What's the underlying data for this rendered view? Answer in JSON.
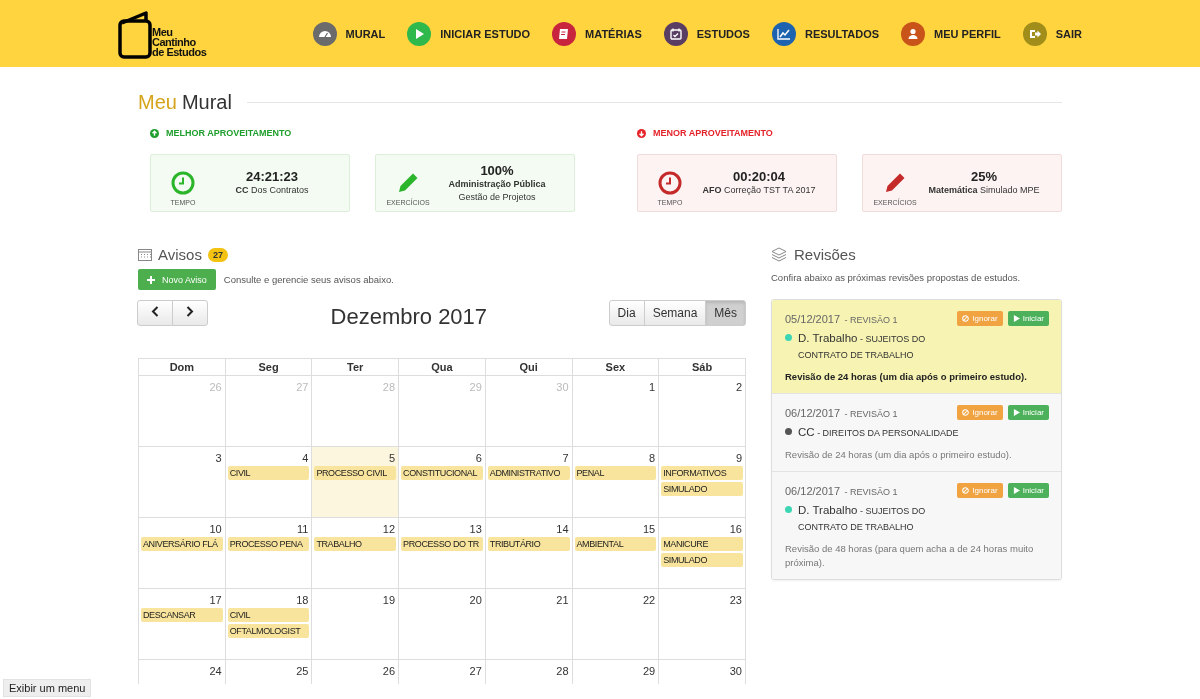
{
  "header": {
    "logo_lines": [
      "Meu",
      "Cantinho",
      "de Estudos"
    ],
    "nav": [
      {
        "kind": "dashboard",
        "label": "MURAL",
        "color": "#6b6b6b"
      },
      {
        "kind": "play",
        "label": "INICIAR ESTUDO",
        "color": "#2fb84b"
      },
      {
        "kind": "book",
        "label": "MATÉRIAS",
        "color": "#c8243d"
      },
      {
        "kind": "calendar",
        "label": "ESTUDOS",
        "color": "#5a3d63"
      },
      {
        "kind": "chart",
        "label": "RESULTADOS",
        "color": "#1e63b0"
      },
      {
        "kind": "user",
        "label": "MEU PERFIL",
        "color": "#c95419"
      },
      {
        "kind": "exit",
        "label": "SAIR",
        "color": "#a08d1a"
      }
    ]
  },
  "mural": {
    "title_accent": "Meu",
    "title": "Mural",
    "groups": [
      {
        "positive": true,
        "label": "MELHOR APROVEITAMENTO",
        "cards": [
          {
            "kind": "time",
            "caption": "TEMPO",
            "value": "24:21:23",
            "line": "**CC** Dos Contratos"
          },
          {
            "kind": "exercise",
            "caption": "EXERCÍCIOS",
            "value": "100%",
            "line": "**Administração Pública** Gestão de Projetos"
          }
        ]
      },
      {
        "positive": false,
        "label": "MENOR APROVEITAMENTO",
        "cards": [
          {
            "kind": "time",
            "caption": "TEMPO",
            "value": "00:20:04",
            "line": "**AFO** Correção TST TA 2017"
          },
          {
            "kind": "exercise",
            "caption": "EXERCÍCIOS",
            "value": "25%",
            "line": "**Matemática** Simulado MPE"
          }
        ]
      }
    ]
  },
  "avisos": {
    "title": "Avisos",
    "count": "27",
    "new_button": "Novo Aviso",
    "hint": "Consulte e gerencie seus avisos abaixo.",
    "calendar": {
      "title": "Dezembro 2017",
      "views": [
        {
          "label": "Dia",
          "selected": false
        },
        {
          "label": "Semana",
          "selected": false
        },
        {
          "label": "Mês",
          "selected": true
        }
      ],
      "weekdays": [
        "Dom",
        "Seg",
        "Ter",
        "Qua",
        "Qui",
        "Sex",
        "Sáb"
      ],
      "weeks": [
        [
          {
            "day": "26",
            "muted": true,
            "today": false
          },
          {
            "day": "27",
            "muted": true,
            "today": false
          },
          {
            "day": "28",
            "muted": true,
            "today": false
          },
          {
            "day": "29",
            "muted": true,
            "today": false
          },
          {
            "day": "30",
            "muted": true,
            "today": false
          },
          {
            "day": "1",
            "muted": false,
            "today": false
          },
          {
            "day": "2",
            "muted": false,
            "today": false
          }
        ],
        [
          {
            "day": "3",
            "muted": false,
            "today": false
          },
          {
            "day": "4",
            "muted": false,
            "today": false,
            "events": [
              "CIVIL"
            ]
          },
          {
            "day": "5",
            "muted": false,
            "today": true,
            "events": [
              "PROCESSO CIVIL"
            ]
          },
          {
            "day": "6",
            "muted": false,
            "today": false,
            "events": [
              "CONSTITUCIONAL"
            ]
          },
          {
            "day": "7",
            "muted": false,
            "today": false,
            "events": [
              "ADMINISTRATIVO"
            ]
          },
          {
            "day": "8",
            "muted": false,
            "today": false,
            "events": [
              "PENAL"
            ]
          },
          {
            "day": "9",
            "muted": false,
            "today": false,
            "events": [
              "INFORMATIVOS",
              "SIMULADO"
            ]
          }
        ],
        [
          {
            "day": "10",
            "muted": false,
            "today": false,
            "events": [
              "ANIVERSÁRIO FLÁ"
            ]
          },
          {
            "day": "11",
            "muted": false,
            "today": false,
            "events": [
              "PROCESSO PENA"
            ]
          },
          {
            "day": "12",
            "muted": false,
            "today": false,
            "events": [
              "TRABALHO"
            ]
          },
          {
            "day": "13",
            "muted": false,
            "today": false,
            "events": [
              "PROCESSO DO TR"
            ]
          },
          {
            "day": "14",
            "muted": false,
            "today": false,
            "events": [
              "TRIBUTÁRIO"
            ]
          },
          {
            "day": "15",
            "muted": false,
            "today": false,
            "events": [
              "AMBIENTAL"
            ]
          },
          {
            "day": "16",
            "muted": false,
            "today": false,
            "events": [
              "MANICURE",
              "SIMULADO"
            ]
          }
        ],
        [
          {
            "day": "17",
            "muted": false,
            "today": false,
            "events": [
              "DESCANSAR"
            ]
          },
          {
            "day": "18",
            "muted": false,
            "today": false,
            "events": [
              "CIVIL",
              "OFTALMOLOGIST"
            ]
          },
          {
            "day": "19",
            "muted": false,
            "today": false
          },
          {
            "day": "20",
            "muted": false,
            "today": false
          },
          {
            "day": "21",
            "muted": false,
            "today": false
          },
          {
            "day": "22",
            "muted": false,
            "today": false
          },
          {
            "day": "23",
            "muted": false,
            "today": false
          }
        ],
        [
          {
            "day": "24",
            "muted": false,
            "today": false
          },
          {
            "day": "25",
            "muted": false,
            "today": false
          },
          {
            "day": "26",
            "muted": false,
            "today": false
          },
          {
            "day": "27",
            "muted": false,
            "today": false
          },
          {
            "day": "28",
            "muted": false,
            "today": false
          },
          {
            "day": "29",
            "muted": false,
            "today": false
          },
          {
            "day": "30",
            "muted": false,
            "today": false
          }
        ]
      ]
    }
  },
  "revisoes": {
    "title": "Revisões",
    "subtitle": "Confira abaixo as próximas revisões propostas de estudos.",
    "items": [
      {
        "highlighted": true,
        "date": "05/12/2017",
        "label": "- REVISÃO 1",
        "subject": "D. Trabalho",
        "topic": "- SUJEITOS DO CONTRATO DE TRABALHO",
        "color": "#3dd6b5",
        "note": "Revisão de 24 horas (um dia após o primeiro estudo).",
        "actions": [
          {
            "kind": "ignore",
            "label": "Ignorar"
          },
          {
            "kind": "start",
            "label": "Iniciar"
          }
        ]
      },
      {
        "highlighted": false,
        "date": "06/12/2017",
        "label": "- REVISÃO 1",
        "subject": "CC",
        "topic": "- DIREITOS DA PERSONALIDADE",
        "color": "#555555",
        "note": "Revisão de 24 horas (um dia após o primeiro estudo).",
        "actions": [
          {
            "kind": "ignore",
            "label": "Ignorar"
          },
          {
            "kind": "start",
            "label": "Iniciar"
          }
        ]
      },
      {
        "highlighted": false,
        "date": "06/12/2017",
        "label": "- REVISÃO 1",
        "subject": "D. Trabalho",
        "topic": "- SUJEITOS DO CONTRATO DE TRABALHO",
        "color": "#3dd6b5",
        "note": "Revisão de 48 horas (para quem acha a de 24 horas muito próxima).",
        "actions": [
          {
            "kind": "ignore",
            "label": "Ignorar"
          },
          {
            "kind": "start",
            "label": "Iniciar"
          }
        ]
      }
    ]
  },
  "menu_hint": "Exibir um menu"
}
